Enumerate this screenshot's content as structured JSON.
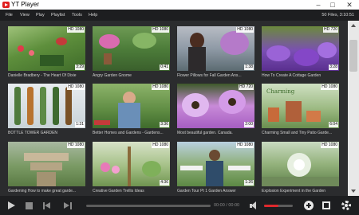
{
  "window": {
    "title": "YT Player",
    "minimize": "–",
    "maximize": "□",
    "close": "✕"
  },
  "menu": {
    "items": [
      "File",
      "View",
      "Play",
      "Playlist",
      "Tools",
      "Help"
    ],
    "file_info": "50 Files, 3:10:51"
  },
  "colors": {
    "accent": "#e0282c",
    "menubar": "#1d1e20",
    "grid_bg": "#2b2c2e"
  },
  "videos": [
    {
      "title": "Danielle Bradbery - The Heart Of Dixie",
      "quality": "HD 1080",
      "duration": "3:29"
    },
    {
      "title": "Angry Garden Gnome",
      "quality": "HD 1080",
      "duration": "0:41"
    },
    {
      "title": "Flower Pillows for Fall     Garden Ans...",
      "quality": "HD 1080",
      "duration": "1:38"
    },
    {
      "title": "How To Create A Cottage Garden",
      "quality": "HD 720",
      "duration": "3:28"
    },
    {
      "title": "BOTTLE TOWER GARDEN",
      "quality": "HD 1080",
      "duration": "1:31"
    },
    {
      "title": "Better Homes and Gardens - Gardens...",
      "quality": "HD 1080",
      "duration": "3:36"
    },
    {
      "title": "Most beautiful garden.  Canada.",
      "quality": "HD 720",
      "duration": "2:00"
    },
    {
      "title": "Charming Small and Tiny Patio Garde...",
      "quality": "HD 1080",
      "duration": "6:04"
    },
    {
      "title": "Gardening  How to make great garde...",
      "quality": "HD 1080",
      "duration": ""
    },
    {
      "title": "Creative Garden Trellis Ideas",
      "quality": "HD 1080",
      "duration": "4:36"
    },
    {
      "title": "Garden Tour Pt 1      Garden Answer",
      "quality": "HD 1080",
      "duration": "1:26"
    },
    {
      "title": "Explosion Experiment in the Garden",
      "quality": "HD 1080",
      "duration": ""
    }
  ],
  "player": {
    "time": "00:00 / 00:00",
    "volume_level": 0.5
  }
}
